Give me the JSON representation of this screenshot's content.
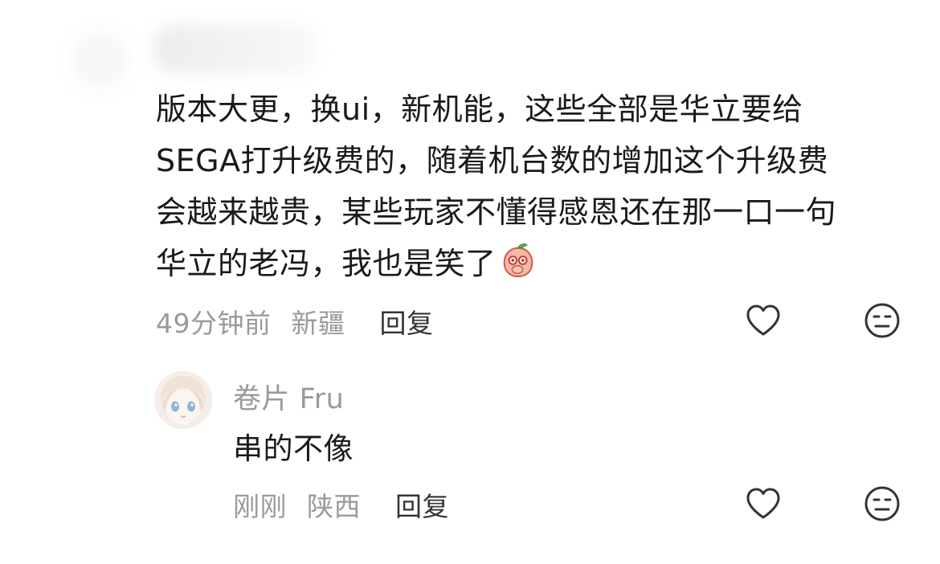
{
  "comment": {
    "lines": [
      "版本大更，换ui，新机能，这些全部是华立要给",
      "SEGA打升级费的，随着机台数的增加这个升级费",
      "会越来越贵，某些玩家不懂得感恩还在那一口一句",
      "华立的老冯，我也是笑了"
    ],
    "emoji": "peach-cover-mouth-emoji",
    "time": "49分钟前",
    "location": "新疆",
    "reply_label": "回复",
    "like_icon": "heart-outline-icon",
    "dislike_icon": "meh-face-icon"
  },
  "reply": {
    "username": "卷片 Fru",
    "text": "串的不像",
    "time": "刚刚",
    "location": "陕西",
    "reply_label": "回复",
    "avatar_icon": "anime-girl-avatar",
    "like_icon": "heart-outline-icon",
    "dislike_icon": "meh-face-icon"
  },
  "colors": {
    "text": "#1a1a1a",
    "meta": "#9a9a9a",
    "icon": "#333333"
  }
}
